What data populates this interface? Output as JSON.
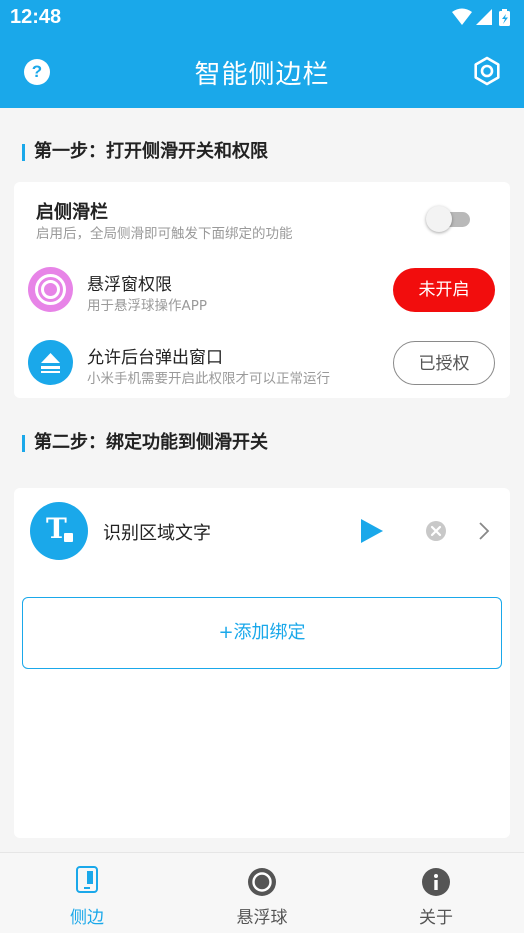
{
  "status_bar": {
    "time": "12:48"
  },
  "app_bar": {
    "title": "智能侧边栏",
    "help_icon": "?"
  },
  "step1": {
    "title": "第一步：打开侧滑开关和权限",
    "sidebar_toggle": {
      "title": "启侧滑栏",
      "subtitle": "启用后，全局侧滑即可触发下面绑定的功能",
      "enabled": false
    },
    "float_permission": {
      "title": "悬浮窗权限",
      "subtitle": "用于悬浮球操作APP",
      "button": "未开启",
      "icon_color": "#e784e7"
    },
    "background_popup": {
      "title": "允许后台弹出窗口",
      "subtitle": "小米手机需要开启此权限才可以正常运行",
      "button": "已授权",
      "icon_color": "#1aa8ea"
    }
  },
  "step2": {
    "title": "第二步：绑定功能到侧滑开关",
    "bound_items": [
      {
        "label": "识别区域文字",
        "icon_letter": "T"
      }
    ],
    "add_button": "+添加绑定"
  },
  "bottom_nav": {
    "items": [
      {
        "label": "侧边",
        "active": true
      },
      {
        "label": "悬浮球",
        "active": false
      },
      {
        "label": "关于",
        "active": false
      }
    ]
  },
  "colors": {
    "primary": "#1aa8ea",
    "danger": "#f20d0d",
    "text_secondary": "#9a9a9a"
  }
}
